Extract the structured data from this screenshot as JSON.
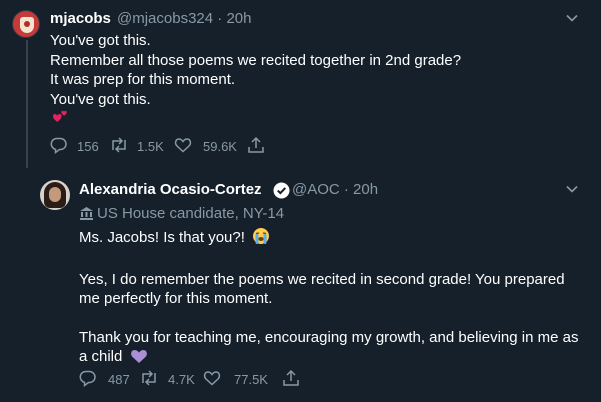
{
  "tweet1": {
    "display_name": "mjacobs",
    "handle_time": "@mjacobs324 · 20h",
    "lines": [
      "You've got this.",
      "Remember all those poems we recited together in 2nd grade?",
      "It was prep for this moment.",
      "You've got this."
    ],
    "emoji": "heart-emoji",
    "replies": "156",
    "retweets": "1.5K",
    "likes": "59.6K"
  },
  "tweet2": {
    "display_name": "Alexandria Ocasio-Cortez",
    "handle_time": "@AOC · 20h",
    "bio": "US House candidate, NY-14",
    "para1": "Ms. Jacobs! Is that you?!",
    "para2": "Yes, I do remember the poems we recited in second grade! You prepared me perfectly for this moment.",
    "para3": "Thank you for teaching me, encouraging my growth, and believing in me as a child",
    "replies": "487",
    "retweets": "4.7K",
    "likes": "77.5K"
  },
  "colors": {
    "background": "#15202b",
    "text": "#ffffff",
    "secondary": "#8899a6",
    "verified": "#ffffff",
    "heart": "#e0245e",
    "purple_heart": "#aa8ed6"
  }
}
